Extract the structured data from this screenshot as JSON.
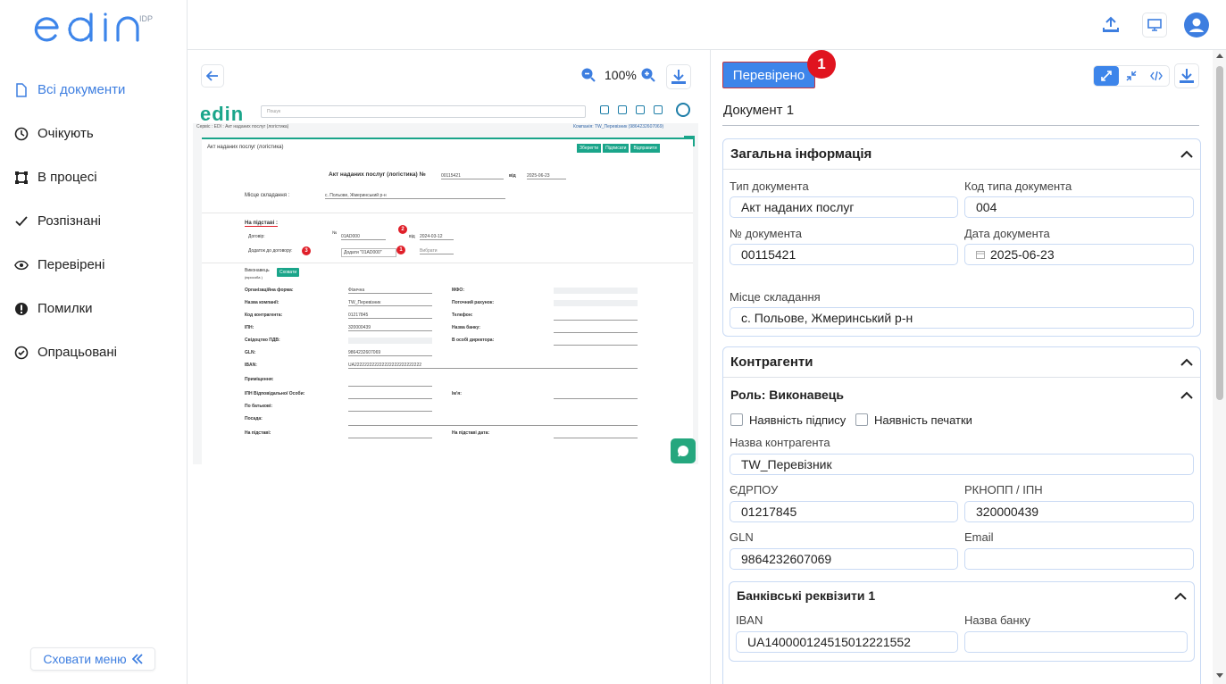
{
  "app": {
    "logo_idp": "IDP"
  },
  "sidebar": {
    "items": [
      {
        "label": "Всі документи",
        "icon": "document-icon"
      },
      {
        "label": "Очікують",
        "icon": "clock-icon"
      },
      {
        "label": "В процесі",
        "icon": "process-icon"
      },
      {
        "label": "Розпізнані",
        "icon": "check-icon"
      },
      {
        "label": "Перевірені",
        "icon": "eye-icon"
      },
      {
        "label": "Помилки",
        "icon": "error-icon"
      },
      {
        "label": "Опрацьовані",
        "icon": "check-circle-icon"
      }
    ],
    "hide_menu": "Сховати меню"
  },
  "viewer": {
    "zoom": "100%",
    "preview": {
      "search_placeholder": "Пошук",
      "crumb": "Сервіс : EDI : Акт наданих послуг (логістика)",
      "company": "Компанія: TW_Перевізник (9864232607069)",
      "title_left": "Акт наданих послуг (логістика)",
      "actions": [
        "Зберегти",
        "Підписати",
        "Відправити"
      ],
      "doc_title": "Акт наданих послуг (логістика) №",
      "doc_no": "00115421",
      "from_label": "від",
      "doc_date": "2025-06-23",
      "place_label": "Місце складання :",
      "place_value": "с. Польове, Жмеринський р-н",
      "basis_label": "На підставі :",
      "contract_label": "Договір:",
      "contract_no_label": "№",
      "contract_no": "01AD000",
      "contract_from": "від",
      "contract_date": "2024-03-12",
      "addendum_label": "Додаток до договору:",
      "addendum_hint": "Додати \"01AD000\"",
      "choose": "Вибрати",
      "executor_label": "Виконавець",
      "executor_sub": "(юрособа )",
      "show_btn": "Сховати",
      "rows_left": [
        "Організаційна форма:",
        "Назва компанії:",
        "Код контрагента:",
        "ІПН:",
        "Свідоцтво ПДВ:",
        "GLN:",
        "IBAN:",
        "Приміщення:",
        "ІПН Відповідальної Особи:",
        "По батькові:",
        "Посада:",
        "На підставі:"
      ],
      "vals_left": [
        "Фізична",
        "TW_Перевізник",
        "01217845",
        "320000439",
        "",
        "9864232607069",
        "UA222222222222222222222222222"
      ],
      "rows_right": [
        "МФО:",
        "Поточний рахунок:",
        "Телефон:",
        "Назва банку:",
        "В особі директора:"
      ],
      "name_label": "Ім'я:",
      "basis_date_label": "На підставі дата:",
      "badges": [
        "1",
        "2",
        "3"
      ]
    }
  },
  "form": {
    "verified_btn": "Перевірено",
    "badge": "1",
    "doc_tab": "Документ 1",
    "general": {
      "title": "Загальна інформація",
      "doc_type_label": "Тип документа",
      "doc_type": "Акт наданих послуг",
      "doc_type_code_label": "Код типа документа",
      "doc_type_code": "004",
      "doc_no_label": "№ документа",
      "doc_no": "00115421",
      "doc_date_label": "Дата документа",
      "doc_date": "2025-06-23",
      "place_label": "Місце складання",
      "place": "с. Польове, Жмеринський р-н"
    },
    "contractors": {
      "title": "Контрагенти",
      "role": "Роль: Виконавець",
      "sign_label": "Наявність підпису",
      "stamp_label": "Наявність печатки",
      "name_label": "Назва контрагента",
      "name": "TW_Перевізник",
      "edrpou_label": "ЄДРПОУ",
      "edrpou": "01217845",
      "rnokpp_label": "РКНОПП / ІПН",
      "rnokpp": "320000439",
      "gln_label": "GLN",
      "gln": "9864232607069",
      "email_label": "Email",
      "email": "",
      "bank": {
        "title": "Банківські реквізити 1",
        "iban_label": "IBAN",
        "iban": "UA140000124515012221552",
        "bank_name_label": "Назва банку",
        "bank_name": ""
      }
    }
  },
  "colors": {
    "accent": "#3d85ea",
    "badge": "#e0141f",
    "green": "#1aa58a"
  }
}
